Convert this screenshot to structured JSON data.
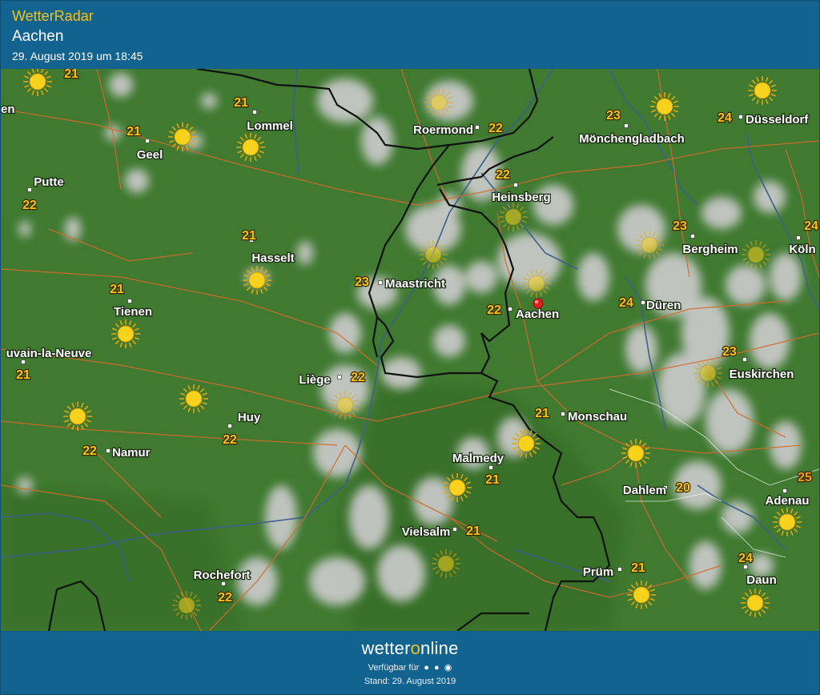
{
  "header": {
    "app_title": "WetterRadar",
    "location": "Aachen",
    "datetime": "29. August 2019 um 18:45"
  },
  "footer": {
    "brand_prefix": "wetter",
    "brand_o": "o",
    "brand_suffix": "nline",
    "available_text": "Verfügbar für",
    "platform_icons": [
      "android-icon",
      "apple-icon",
      "web-icon"
    ],
    "status": "Stand: 29. August 2019"
  },
  "colors": {
    "header_bg": "#136390",
    "title_yellow": "#f3c21a",
    "land": "#3f7a30",
    "cloud": "#c9c9c9",
    "border": "#111111",
    "road": "#d46a2e",
    "river": "#3d5e8e",
    "temp_yellow": "#f6c413",
    "sun": "#f8d21c"
  },
  "cities": [
    {
      "name": "Lommel",
      "temp": "21"
    },
    {
      "name": "Geel",
      "temp": "21"
    },
    {
      "name": "Putte",
      "temp": "22"
    },
    {
      "name": "Roermond",
      "temp": "22"
    },
    {
      "name": "Mönchengladbach",
      "temp": "23"
    },
    {
      "name": "Düsseldorf",
      "temp": "24"
    },
    {
      "name": "Heinsberg",
      "temp": "22"
    },
    {
      "name": "Hasselt",
      "temp": "21"
    },
    {
      "name": "Maastricht",
      "temp": "23"
    },
    {
      "name": "Bergheim",
      "temp": "23"
    },
    {
      "name": "Köln",
      "temp": "24"
    },
    {
      "name": "Tienen",
      "temp": "21"
    },
    {
      "name": "Aachen",
      "temp": "22"
    },
    {
      "name": "Düren",
      "temp": "24"
    },
    {
      "name": "uvain-la-Neuve",
      "temp": "21"
    },
    {
      "name": "Euskirchen",
      "temp": "23"
    },
    {
      "name": "Liège",
      "temp": "22"
    },
    {
      "name": "Huy",
      "temp": "22"
    },
    {
      "name": "Monschau",
      "temp": "21"
    },
    {
      "name": "Namur",
      "temp": "22"
    },
    {
      "name": "Malmedy",
      "temp": "21"
    },
    {
      "name": "Dahlem",
      "temp": "20"
    },
    {
      "name": "Adenau",
      "temp": "25"
    },
    {
      "name": "Vielsalm",
      "temp": "21"
    },
    {
      "name": "Daun",
      "temp": "24"
    },
    {
      "name": "Prüm",
      "temp": "21"
    },
    {
      "name": "Rochefort",
      "temp": "22"
    }
  ],
  "edge_labels": {
    "top_left_temp": "21",
    "left_partial": "en"
  },
  "marker": {
    "name": "location-pin-icon"
  }
}
